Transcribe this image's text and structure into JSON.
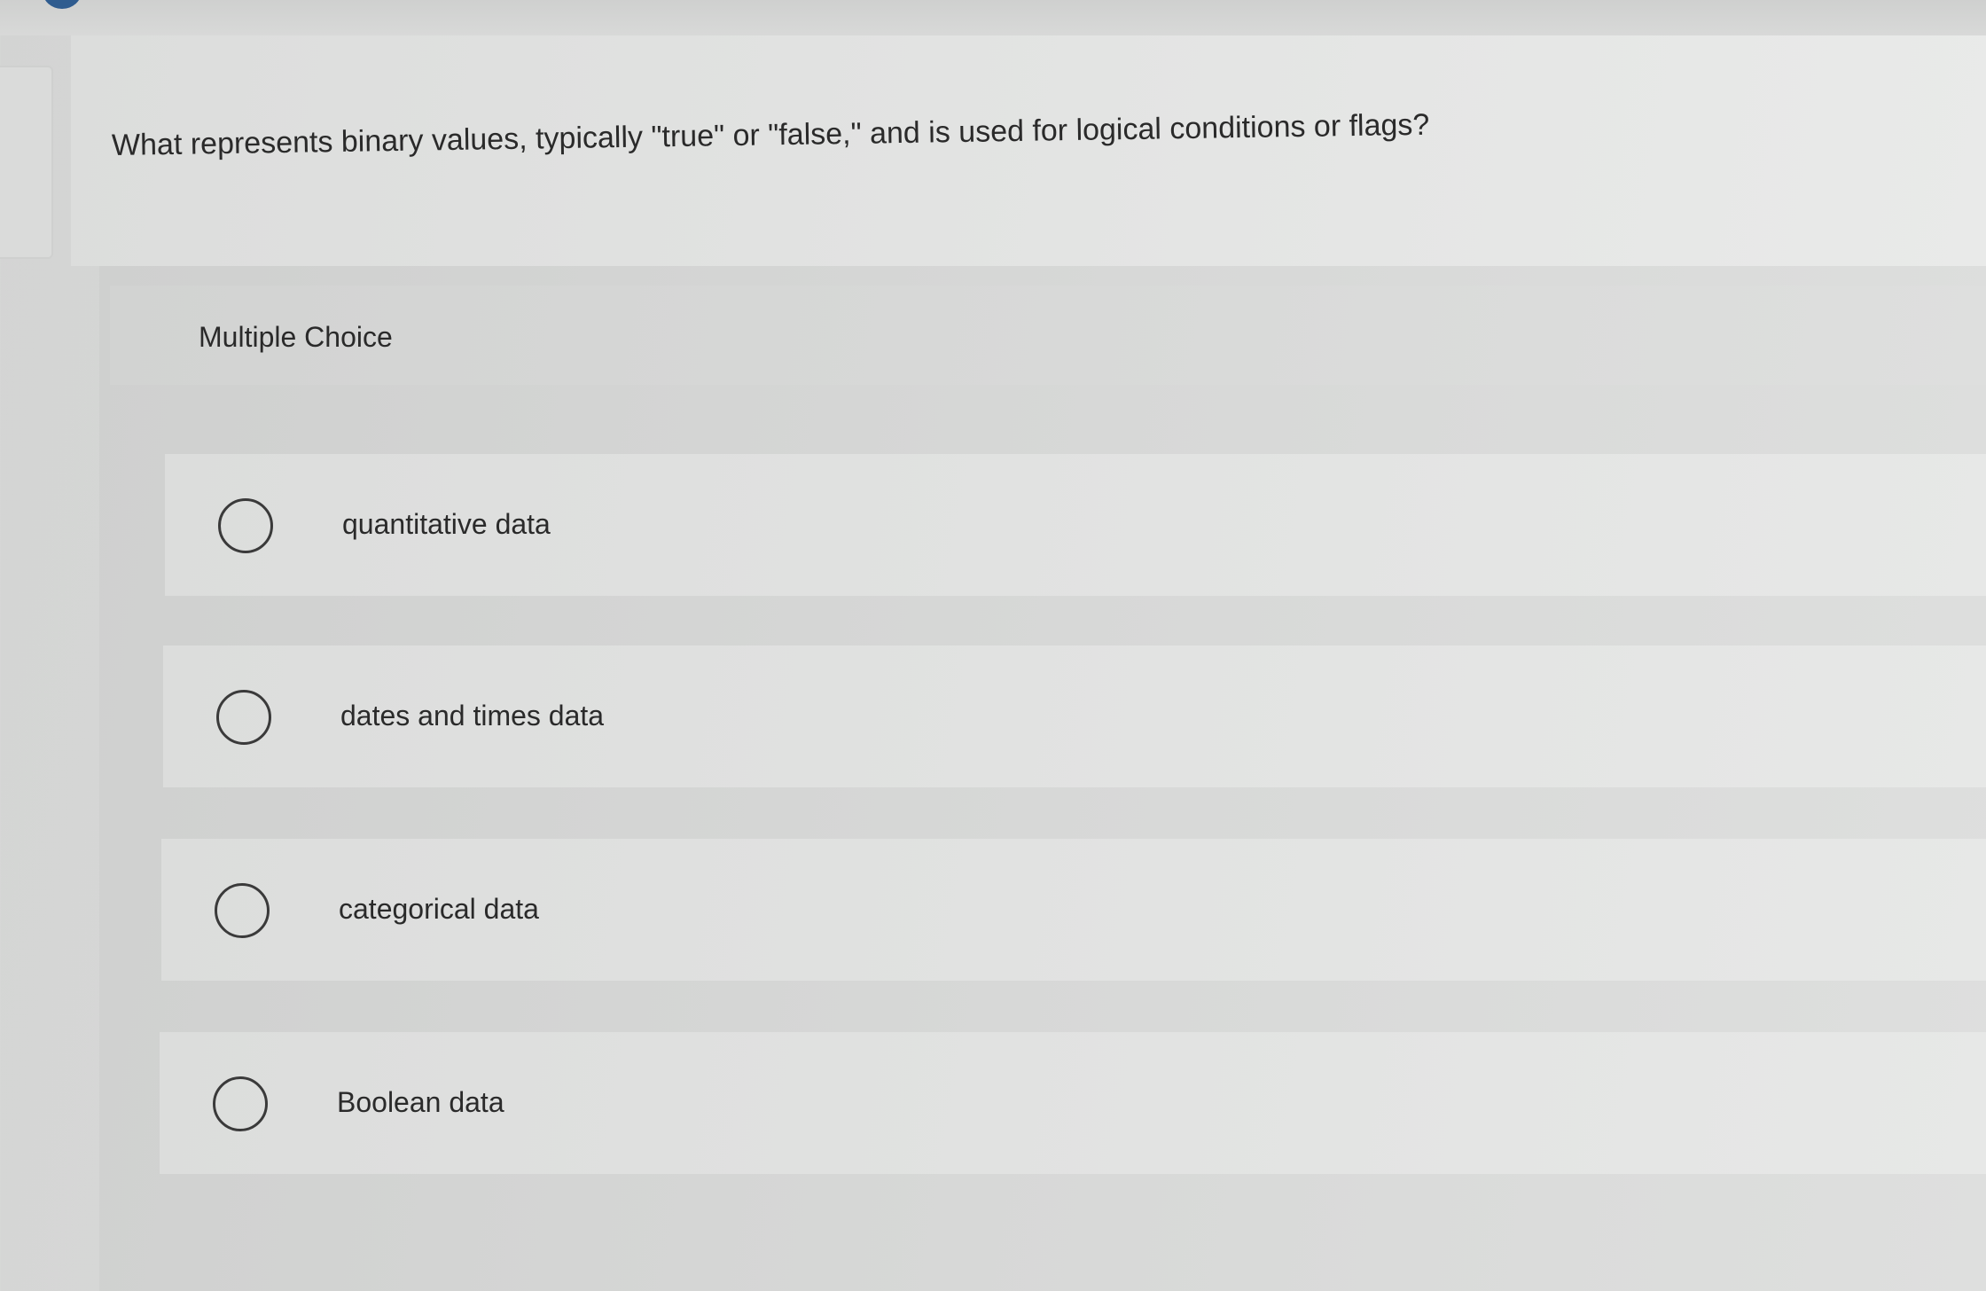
{
  "question": {
    "text": "What represents binary values, typically \"true\" or \"false,\" and is used for logical conditions or flags?"
  },
  "panel": {
    "label": "Multiple Choice"
  },
  "options": [
    {
      "label": "quantitative data"
    },
    {
      "label": "dates and times data"
    },
    {
      "label": "categorical data"
    },
    {
      "label": "Boolean data"
    }
  ]
}
